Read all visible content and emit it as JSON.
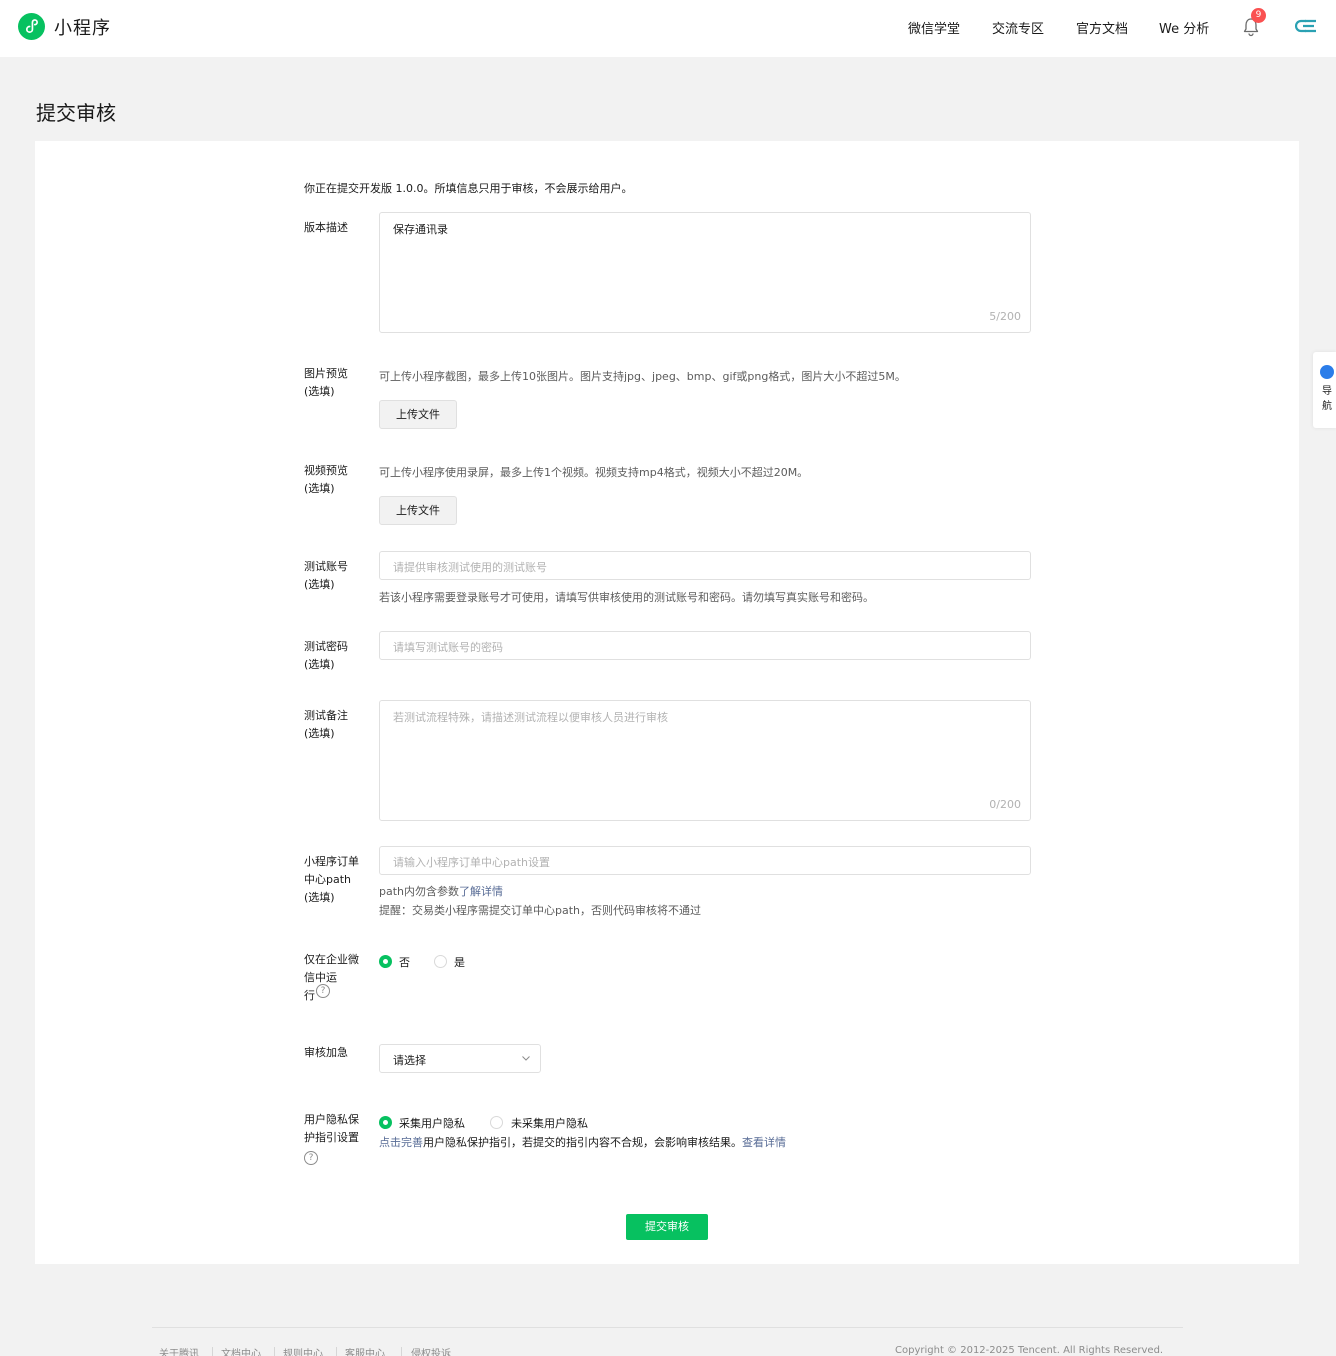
{
  "header": {
    "app_name": "小程序",
    "nav": [
      "微信学堂",
      "交流专区",
      "官方文档",
      "We 分析"
    ],
    "notification_count": "9",
    "brand_color": "#07c160"
  },
  "page": {
    "title": "提交审核"
  },
  "form": {
    "intro": "你正在提交开发版 1.0.0。所填信息只用于审核，不会展示给用户。",
    "version_desc": {
      "label": "版本描述",
      "value": "保存通讯录",
      "counter": "5/200"
    },
    "image_preview": {
      "label_1": "图片预览",
      "label_2": "(选填)",
      "hint": "可上传小程序截图，最多上传10张图片。图片支持jpg、jpeg、bmp、gif或png格式，图片大小不超过5M。",
      "button": "上传文件"
    },
    "video_preview": {
      "label_1": "视频预览",
      "label_2": "(选填)",
      "hint": "可上传小程序使用录屏，最多上传1个视频。视频支持mp4格式，视频大小不超过20M。",
      "button": "上传文件"
    },
    "test_account": {
      "label_1": "测试账号",
      "label_2": "(选填)",
      "placeholder": "请提供审核测试使用的测试账号",
      "hint": "若该小程序需要登录账号才可使用，请填写供审核使用的测试账号和密码。请勿填写真实账号和密码。"
    },
    "test_password": {
      "label_1": "测试密码",
      "label_2": "(选填)",
      "placeholder": "请填写测试账号的密码"
    },
    "test_note": {
      "label_1": "测试备注",
      "label_2": "(选填)",
      "placeholder": "若测试流程特殊，请描述测试流程以便审核人员进行审核",
      "counter": "0/200"
    },
    "order_path": {
      "label_1": "小程序订单",
      "label_2": "中心path",
      "label_3": "(选填)",
      "placeholder": "请输入小程序订单中心path设置",
      "hint_prefix": "path内勿含参数",
      "hint_link": "了解详情",
      "reminder": "提醒：交易类小程序需提交订单中心path，否则代码审核将不通过"
    },
    "wework_only": {
      "label_1": "仅在企业微",
      "label_2": "信中运",
      "label_3": "行",
      "options": [
        "否",
        "是"
      ],
      "selected": "否"
    },
    "expedite": {
      "label": "审核加急",
      "select_value": "请选择"
    },
    "privacy": {
      "label_1": "用户隐私保",
      "label_2": "护指引设置",
      "options": [
        "采集用户隐私",
        "未采集用户隐私"
      ],
      "selected": "采集用户隐私",
      "note_link": "点击完善",
      "note_text": "用户隐私保护指引，若提交的指引内容不合规，会影响审核结果。",
      "note_link2": "查看详情"
    },
    "submit": "提交审核"
  },
  "side_nav": {
    "label": "导航"
  },
  "footer": {
    "links": [
      "关于腾讯",
      "文档中心",
      "规则中心",
      "客服中心",
      "侵权投诉"
    ],
    "copyright": "Copyright © 2012-2025 Tencent. All Rights Reserved."
  }
}
